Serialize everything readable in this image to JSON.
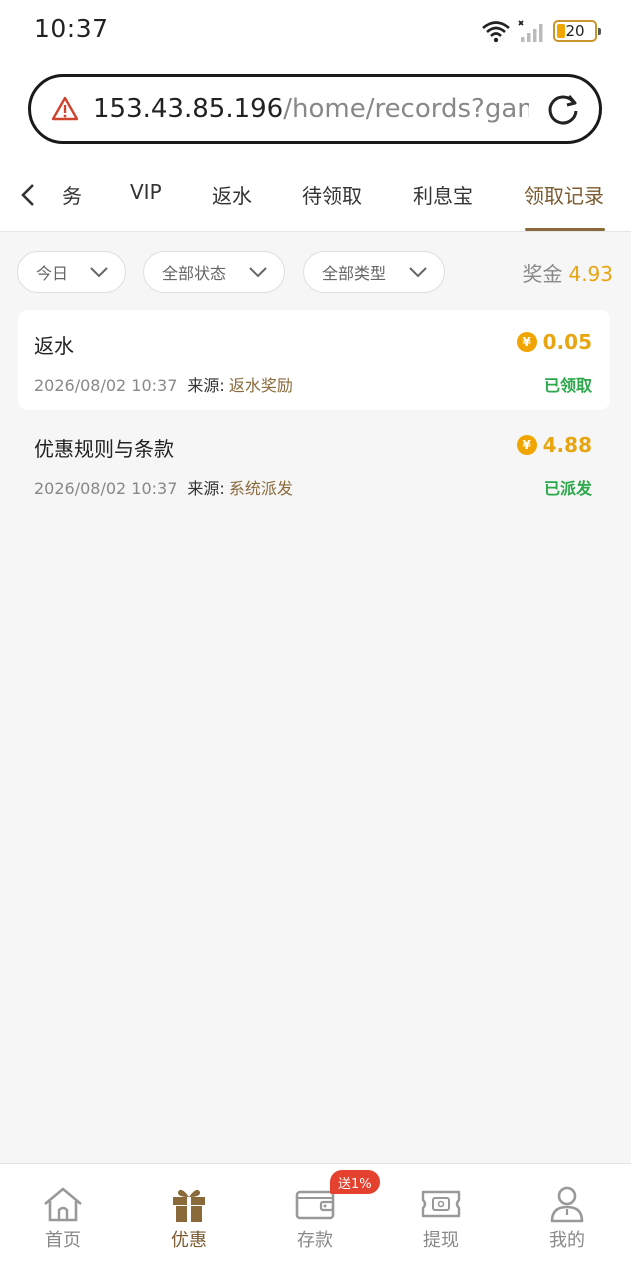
{
  "status_bar": {
    "time": "10:37",
    "battery": "20",
    "icons": [
      "wifi-icon",
      "signal-icon",
      "battery-icon"
    ]
  },
  "url_bar": {
    "host": "153.43.85.196",
    "path": "/home/records?gam",
    "icons": [
      "warning-icon",
      "reload-icon"
    ]
  },
  "tabs": {
    "items": [
      "务",
      "VIP",
      "返水",
      "待领取",
      "利息宝",
      "领取记录"
    ],
    "active": "领取记录"
  },
  "filters": {
    "date": "今日",
    "status": "全部状态",
    "type": "全部类型"
  },
  "bonus": {
    "label": "奖金",
    "amount": "4.93"
  },
  "records": [
    {
      "title": "返水",
      "amount": "0.05",
      "time": "2026/08/02 10:37",
      "source_label": "来源:",
      "source": "返水奖励",
      "status": "已领取"
    },
    {
      "title": "优惠规则与条款",
      "amount": "4.88",
      "time": "2026/08/02 10:37",
      "source_label": "来源:",
      "source": "系统派发",
      "status": "已派发"
    }
  ],
  "coin_symbol": "¥",
  "bottom_nav": {
    "items": [
      "首页",
      "优惠",
      "存款",
      "提现",
      "我的"
    ],
    "active": "优惠",
    "badge": "送1%"
  },
  "colors": {
    "accent": "#7b5b2f",
    "gold": "#e8a512",
    "success": "#2aa84a",
    "badge": "#e4412f"
  }
}
